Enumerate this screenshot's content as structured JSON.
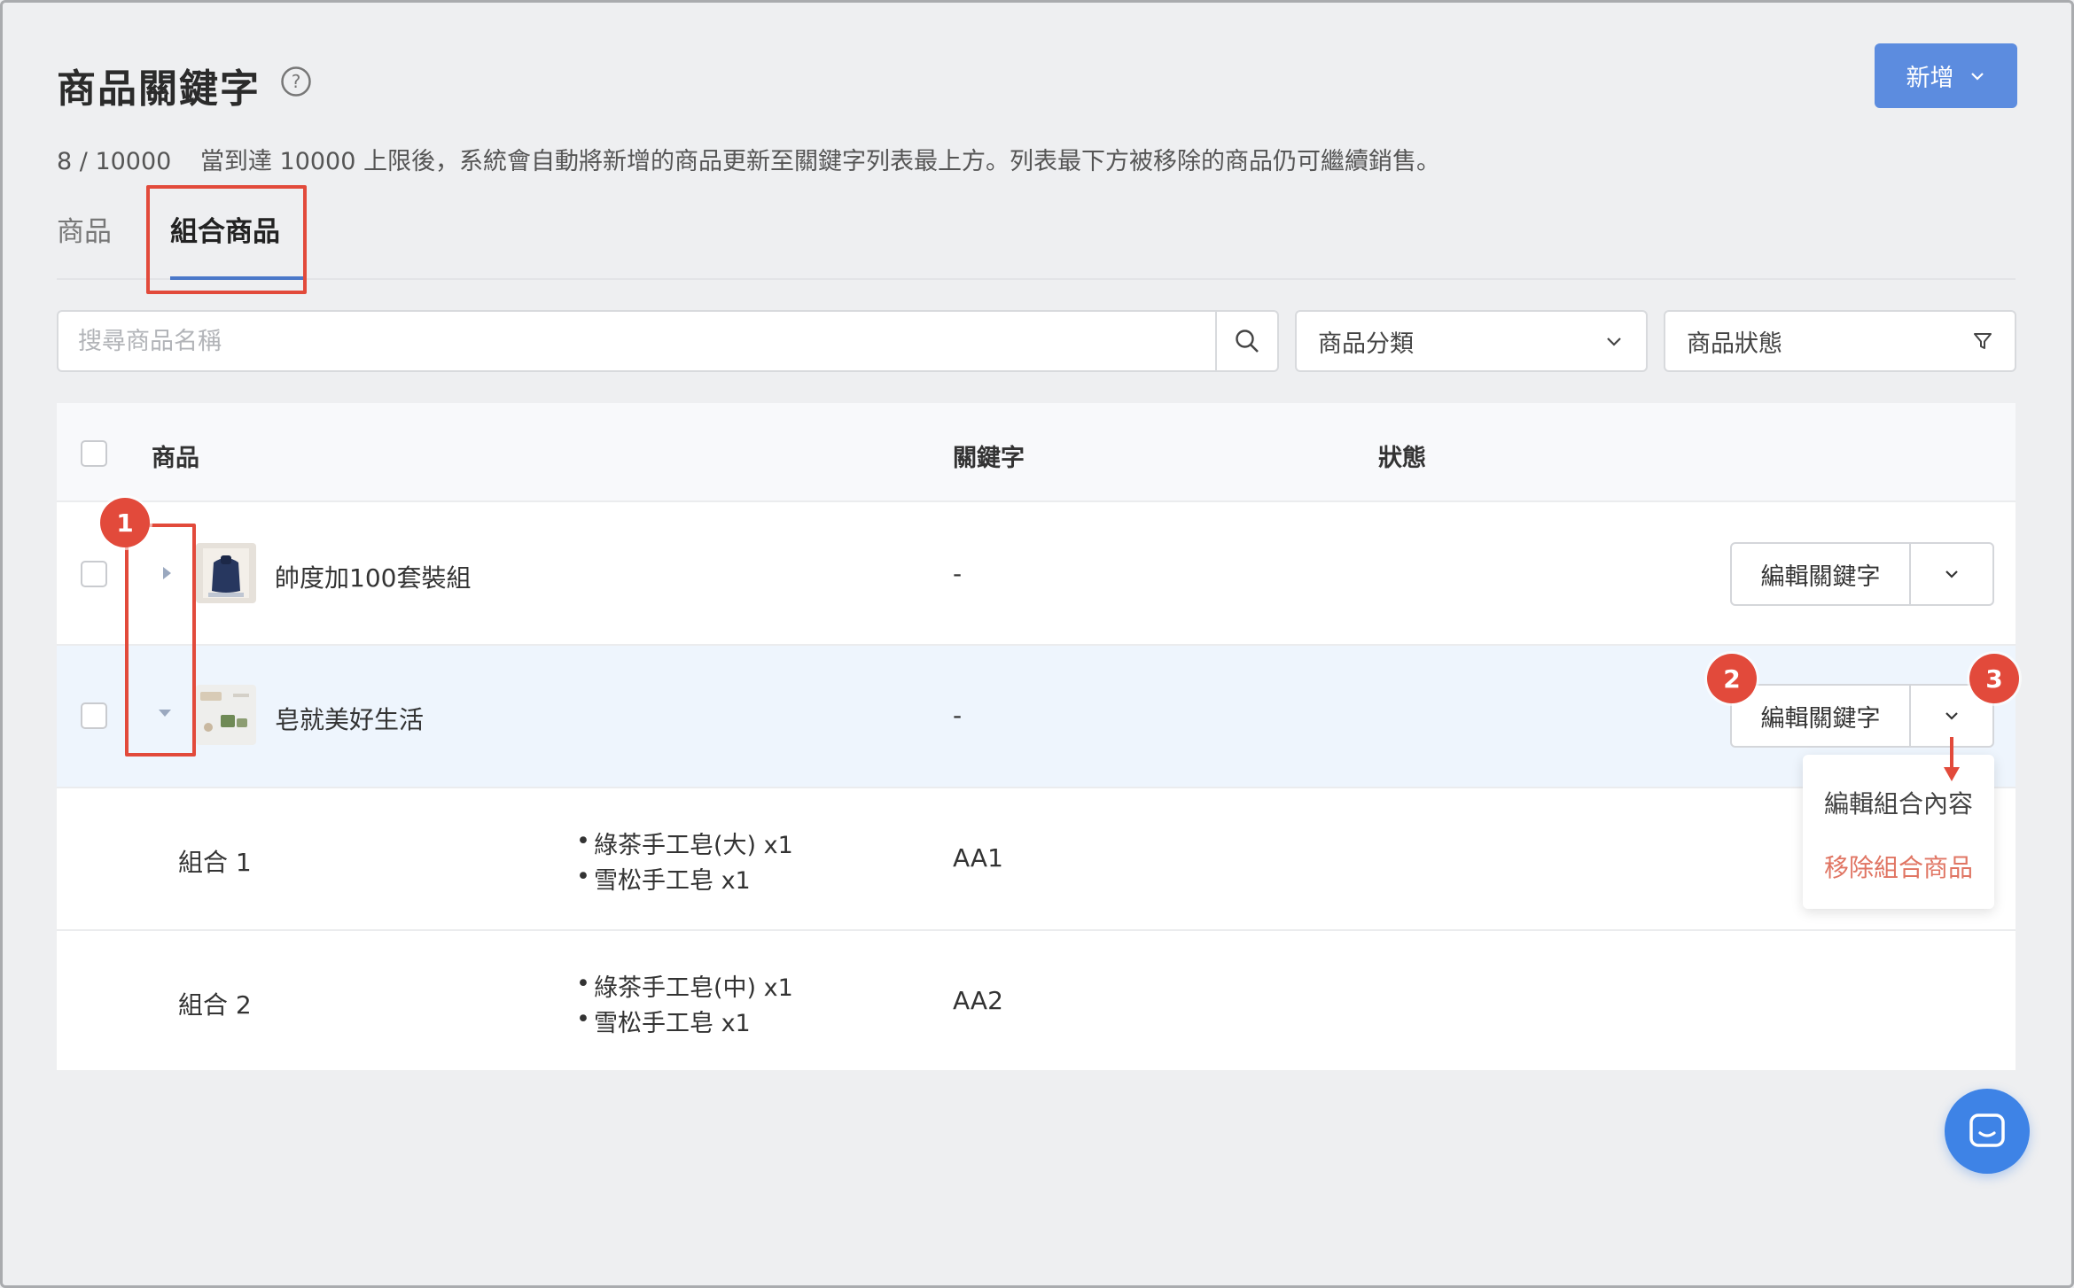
{
  "header": {
    "title": "商品關鍵字",
    "add_button": "新增",
    "count": "8 / 10000",
    "description": "當到達 10000 上限後，系統會自動將新增的商品更新至關鍵字列表最上方。列表最下方被移除的商品仍可繼續銷售。"
  },
  "tabs": [
    {
      "label": "商品",
      "active": false
    },
    {
      "label": "組合商品",
      "active": true
    }
  ],
  "filters": {
    "search_placeholder": "搜尋商品名稱",
    "category": "商品分類",
    "status": "商品狀態"
  },
  "table": {
    "columns": {
      "product": "商品",
      "keyword": "關鍵字",
      "status": "狀態"
    },
    "rows": [
      {
        "name": "帥度加100套裝組",
        "keyword": "-",
        "expanded": false,
        "action": "編輯關鍵字"
      },
      {
        "name": "皂就美好生活",
        "keyword": "-",
        "expanded": true,
        "action": "編輯關鍵字"
      }
    ],
    "bundles": [
      {
        "name": "組合 1",
        "items": [
          "綠茶手工皂(大) x1",
          "雪松手工皂 x1"
        ],
        "keyword": "AA1"
      },
      {
        "name": "組合 2",
        "items": [
          "綠茶手工皂(中) x1",
          "雪松手工皂 x1"
        ],
        "keyword": "AA2"
      }
    ]
  },
  "dropdown_menu": {
    "edit": "編輯組合內容",
    "remove": "移除組合商品"
  },
  "badges": [
    "1",
    "2",
    "3"
  ],
  "colors": {
    "primary": "#5c8cdf",
    "annotation_red": "#e24a3b",
    "danger_text": "#e07563",
    "expanded_row_bg": "#eef5fd",
    "chat_button": "#3e83e6"
  },
  "icons": [
    "help-icon",
    "chevron-down-icon",
    "search-icon",
    "filter-icon",
    "caret-right-icon",
    "caret-down-icon",
    "chat-icon"
  ]
}
